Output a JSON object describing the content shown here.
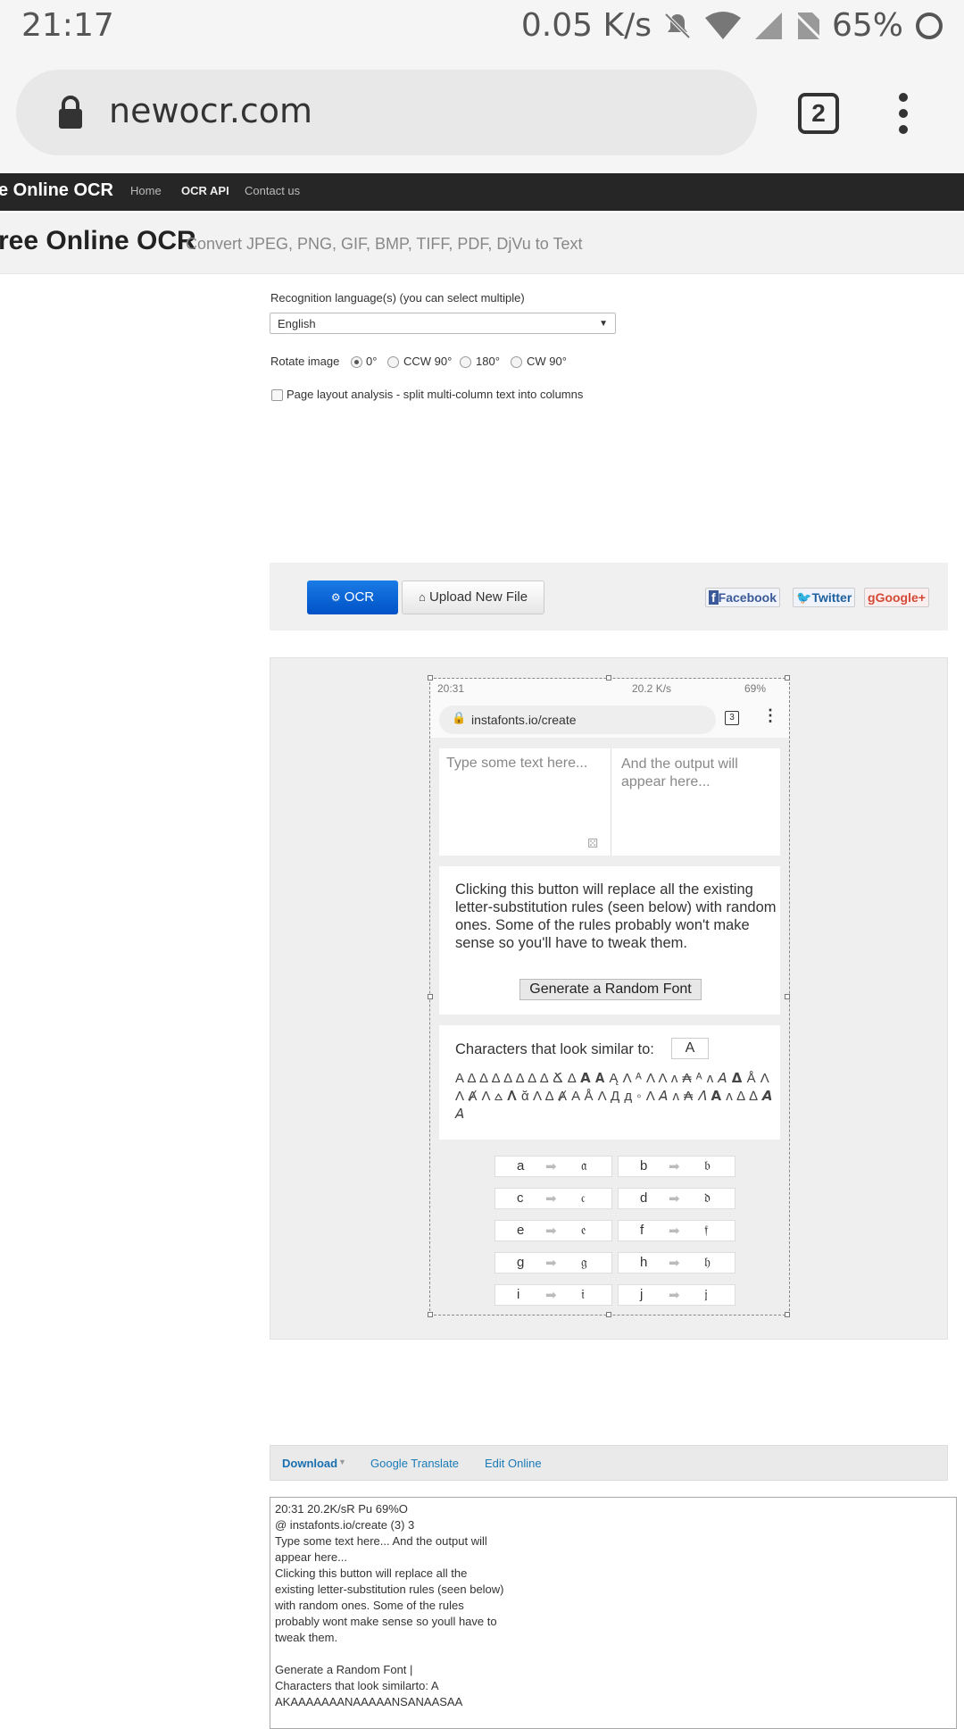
{
  "status_bar": {
    "time": "21:17",
    "speed": "0.05 K/s",
    "battery": "65%"
  },
  "browser": {
    "url": "newocr.com",
    "tab_count": "2"
  },
  "site_nav": {
    "brand": "e Online OCR",
    "links": [
      "Home",
      "OCR API",
      "Contact us"
    ]
  },
  "header": {
    "title": "ree Online OCR",
    "subtitle": "Convert JPEG, PNG, GIF, BMP, TIFF, PDF, DjVu to Text"
  },
  "form": {
    "language_label": "Recognition language(s) (you can select multiple)",
    "language_value": "English",
    "rotate_label": "Rotate image",
    "rotate_options": [
      "0°",
      "CCW 90°",
      "180°",
      "CW 90°"
    ],
    "layout_label": "Page layout analysis - split multi-column text into columns"
  },
  "actions": {
    "ocr": "OCR",
    "upload": "Upload New File",
    "facebook": "Facebook",
    "twitter": "Twitter",
    "google": "Google+"
  },
  "preview": {
    "time": "20:31",
    "status_right": "20.2 K/s",
    "battery": "69%",
    "url": "instafonts.io/create",
    "tabs": "3",
    "input_placeholder": "Type some text here...",
    "output_placeholder": "And the output will appear here...",
    "random_text": "Clicking this button will replace all the existing letter-substitution rules (seen below) with random ones. Some of the rules probably won't make sense so you'll have to tweak them.",
    "random_button": "Generate a Random Font",
    "similar_label": "Characters that look similar to:",
    "similar_char": "A",
    "similar_glyphs": "Α Δ Δ Δ Δ Δ Δ Δ Ճ Δ 𝗔 𝐀 Ą Λ ᴬ Λ Λ ᴧ ₳ ᴬ ᴧ 𝘈 𝝙 Å Λ Λ Ⱥ Λ ⩟ 𝚲 ᾰ Λ Δ Ⱥ Α Å Λ Д д ◦ Λ 𝘈 ᴧ ₳ 𝛬 𝗔 ᴧ Δ ∆ 𝘼 𝘈",
    "rules": [
      [
        "a",
        "𝔞",
        "b",
        "𝔟"
      ],
      [
        "c",
        "𝔠",
        "d",
        "𝔡"
      ],
      [
        "e",
        "𝔢",
        "f",
        "𝔣"
      ],
      [
        "g",
        "𝔤",
        "h",
        "𝔥"
      ],
      [
        "i",
        "𝔦",
        "j",
        "𝔧"
      ]
    ]
  },
  "download_bar": {
    "download": "Download",
    "translate": "Google Translate",
    "edit": "Edit Online"
  },
  "result_text": "20:31 20.2K/sR Pu 69%O\n@ instafonts.io/create (3) 3\nType some text here... And the output will\nappear here...\nClicking this button will replace all the\nexisting letter-substitution rules (seen below)\nwith random ones. Some of the rules\nprobably wont make sense so youll have to\ntweak them.\n\nGenerate a Random Font |\nCharacters that look similarto: A\nAKAAAAAAANAAAAANSANAASAA",
  "colors": {
    "nav_bg": "#262626",
    "ocr_button": "#0052c6",
    "link": "#1a7bb8"
  }
}
